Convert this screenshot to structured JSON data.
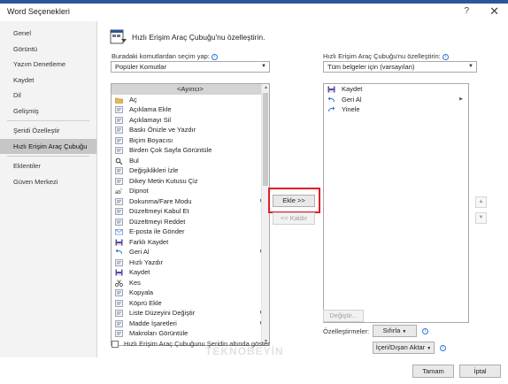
{
  "window": {
    "title": "Word Seçenekleri",
    "help": "?",
    "close": "✕"
  },
  "sidebar": {
    "items": [
      {
        "label": "Genel"
      },
      {
        "label": "Görüntü"
      },
      {
        "label": "Yazım Denetleme"
      },
      {
        "label": "Kaydet"
      },
      {
        "label": "Dil"
      },
      {
        "label": "Gelişmiş"
      },
      {
        "label": "Şeridi Özelleştir"
      },
      {
        "label": "Hızlı Erişim Araç Çubuğu"
      },
      {
        "label": "Eklentiler"
      },
      {
        "label": "Güven Merkezi"
      }
    ]
  },
  "header": {
    "title": "Hızlı Erişim Araç Çubuğu'nu özelleştirin."
  },
  "left": {
    "choose_label": "Buradaki komutlardan seçim yap:",
    "choose_value": "Popüler Komutlar",
    "commands": [
      {
        "label": "<Ayırıcı>",
        "icon": "separator"
      },
      {
        "label": "Aç",
        "icon": "folder-icon"
      },
      {
        "label": "Açıklama Ekle",
        "icon": "comment-add-icon"
      },
      {
        "label": "Açıklamayı Sil",
        "icon": "comment-delete-icon"
      },
      {
        "label": "Baskı Önizle ve Yazdır",
        "icon": "print-preview-icon"
      },
      {
        "label": "Biçim Boyacısı",
        "icon": "format-painter-icon"
      },
      {
        "label": "Birden Çok Sayfa Görüntüle",
        "icon": "multiple-pages-icon"
      },
      {
        "label": "Bul",
        "icon": "find-icon"
      },
      {
        "label": "Değişiklikleri İzle",
        "icon": "track-changes-icon"
      },
      {
        "label": "Dikey Metin Kutusu Çiz",
        "icon": "vertical-textbox-icon"
      },
      {
        "label": "Dipnot",
        "icon": "footnote-icon"
      },
      {
        "label": "Dokunma/Fare Modu",
        "icon": "touch-mode-icon",
        "submenu": true
      },
      {
        "label": "Düzeltmeyi Kabul Et",
        "icon": "accept-change-icon"
      },
      {
        "label": "Düzeltmeyi Reddet",
        "icon": "reject-change-icon"
      },
      {
        "label": "E-posta ile Gönder",
        "icon": "email-icon"
      },
      {
        "label": "Farklı Kaydet",
        "icon": "save-as-icon"
      },
      {
        "label": "Geri Al",
        "icon": "undo-icon",
        "submenu": true
      },
      {
        "label": "Hızlı Yazdır",
        "icon": "quick-print-icon"
      },
      {
        "label": "Kaydet",
        "icon": "save-icon"
      },
      {
        "label": "Kes",
        "icon": "cut-icon"
      },
      {
        "label": "Kopyala",
        "icon": "copy-icon"
      },
      {
        "label": "Köprü Ekle",
        "icon": "hyperlink-icon"
      },
      {
        "label": "Liste Düzeyini Değiştir",
        "icon": "list-level-icon",
        "submenu": true
      },
      {
        "label": "Madde İşaretleri",
        "icon": "bullets-icon",
        "submenu": true
      },
      {
        "label": "Makroları Görüntüle",
        "icon": "macros-icon"
      }
    ],
    "checkbox_label": "Hızlı Erişim Araç Çubuğunu Şeridin altında göster"
  },
  "middle": {
    "add": "Ekle >>",
    "remove": "<< Kaldır"
  },
  "right": {
    "customize_label": "Hızlı Erişim Araç Çubuğu'nu özelleştirin:",
    "scope_value": "Tüm belgeler için (varsayılan)",
    "items": [
      {
        "label": "Kaydet",
        "icon": "save-icon"
      },
      {
        "label": "Geri Al",
        "icon": "undo-icon",
        "submenu": true
      },
      {
        "label": "Yinele",
        "icon": "redo-icon"
      }
    ],
    "modify": "Değiştir...",
    "customizations_label": "Özelleştirmeler:",
    "reset": "Sıfırla",
    "import_export": "İçeri/Dışarı Aktar"
  },
  "footer": {
    "ok": "Tamam",
    "cancel": "İptal"
  },
  "watermark": "TEKNOBEYİN",
  "colors": {
    "accent": "#2b579a",
    "highlight": "#e31b23",
    "selected": "#c6c6c6"
  }
}
